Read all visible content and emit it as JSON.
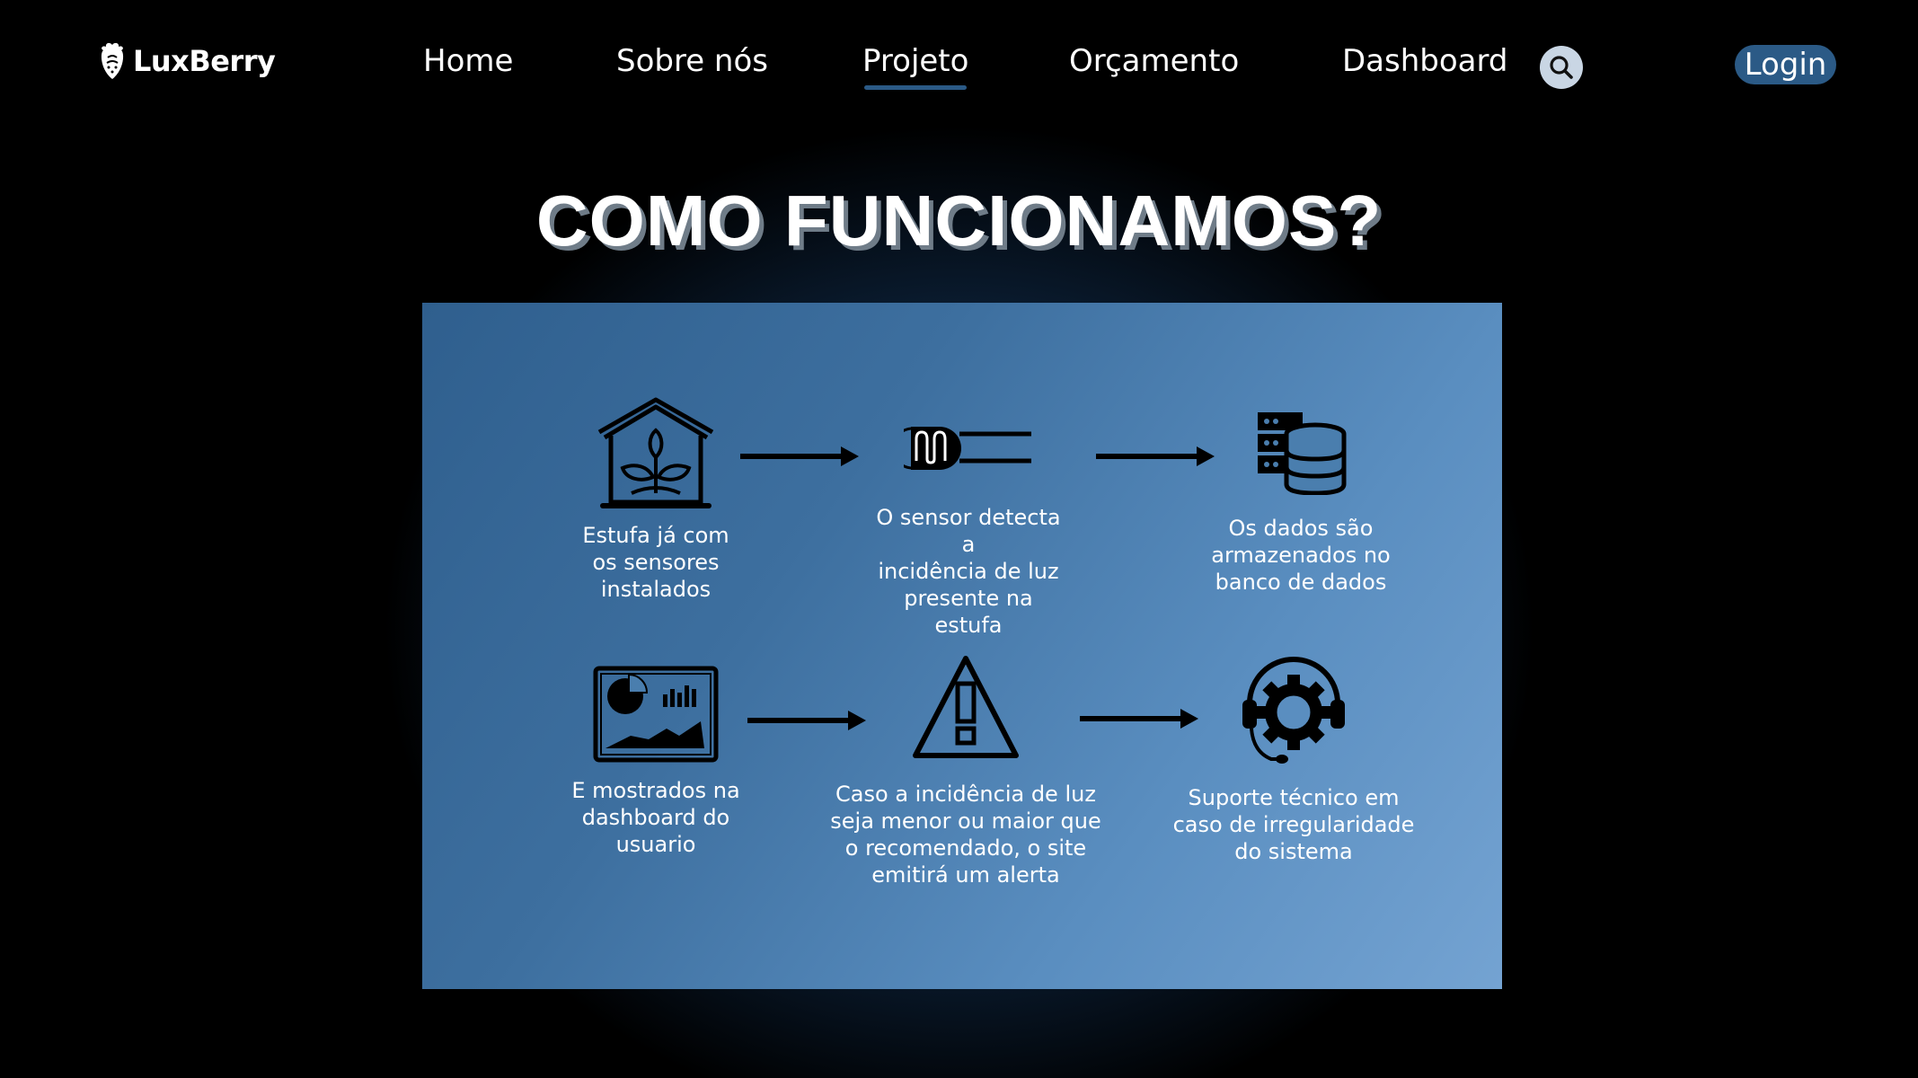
{
  "nav": {
    "brand": "LuxBerry",
    "links": [
      "Home",
      "Sobre nós",
      "Projeto",
      "Orçamento",
      "Dashboard"
    ],
    "active": "Projeto",
    "login_label": "Login"
  },
  "main": {
    "title": "COMO FUNCIONAMOS?",
    "steps": [
      {
        "icon": "greenhouse-icon",
        "text": "Estufa já com\nos sensores\ninstalados"
      },
      {
        "icon": "sensor-icon",
        "text": "O sensor detecta a\nincidência de luz\npresente na estufa"
      },
      {
        "icon": "database-icon",
        "text": "Os dados são\narmazenados no\nbanco de dados"
      },
      {
        "icon": "dashboard-icon",
        "text": "E mostrados na\ndashboard do\nusuario"
      },
      {
        "icon": "warning-icon",
        "text": "Caso a incidência de luz\nseja menor ou maior que\no recomendado, o site\nemitirá um alerta"
      },
      {
        "icon": "support-icon",
        "text": "Suporte técnico em\ncaso de irregularidade\ndo sistema"
      }
    ]
  },
  "colors": {
    "accent": "#2b5a86",
    "panel_start": "#2f5f8e",
    "panel_end": "#74a3d2",
    "background": "#000000"
  }
}
